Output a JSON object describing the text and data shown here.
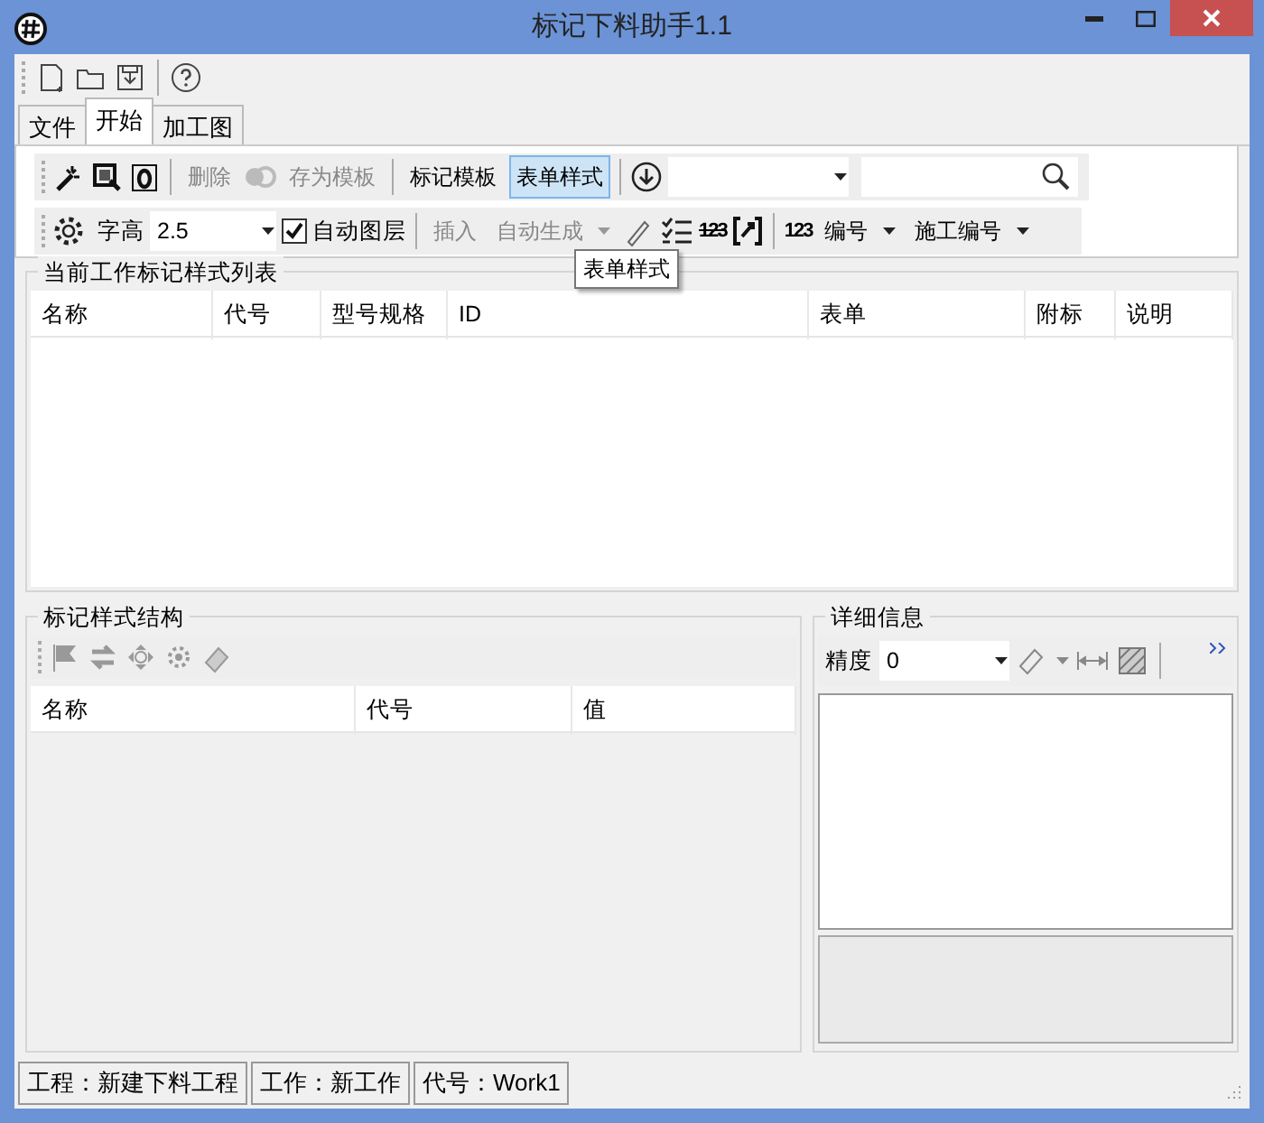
{
  "window": {
    "title": "标记下料助手1.1"
  },
  "tabs": [
    {
      "label": "文件",
      "selected": false
    },
    {
      "label": "开始",
      "selected": true
    },
    {
      "label": "加工图",
      "selected": false
    }
  ],
  "ribbon": {
    "delete": {
      "label": "删除",
      "disabled": true
    },
    "save_template": {
      "label": "存为模板",
      "disabled": true
    },
    "mark_template": {
      "label": "标记模板",
      "disabled": false,
      "selected": false
    },
    "form_style": {
      "label": "表单样式",
      "disabled": false,
      "selected": true
    },
    "font_height": {
      "label": "字高",
      "value": "2.5"
    },
    "auto_layer": {
      "label": "自动图层",
      "checked": true
    },
    "insert": {
      "label": "插入",
      "disabled": true
    },
    "auto_generate": {
      "label": "自动生成",
      "disabled": true
    },
    "number_glyph_1": "123",
    "number_glyph_2": "123",
    "number": {
      "label": "编号"
    },
    "construction_number": {
      "label": "施工编号"
    }
  },
  "tooltip": "表单样式",
  "style_list": {
    "title": "当前工作标记样式列表",
    "columns": [
      "名称",
      "代号",
      "型号规格",
      "ID",
      "表单",
      "附标",
      "说明"
    ]
  },
  "structure": {
    "title": "标记样式结构",
    "columns": [
      "名称",
      "代号",
      "值"
    ]
  },
  "details": {
    "title": "详细信息",
    "precision": {
      "label": "精度",
      "value": "0"
    }
  },
  "status_bar": [
    "工程：新建下料工程",
    "工作：新工作",
    "代号：Work1"
  ]
}
